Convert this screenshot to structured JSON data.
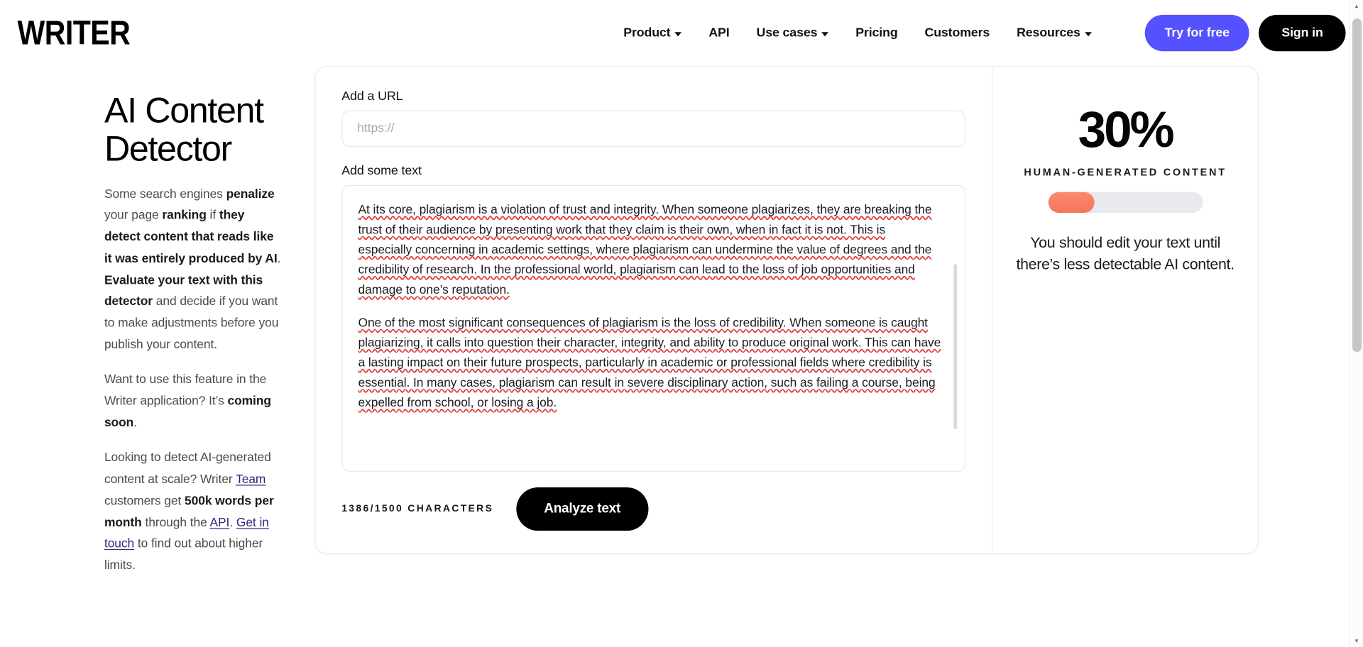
{
  "header": {
    "logo": "WRITER",
    "nav": [
      {
        "label": "Product",
        "has_caret": true
      },
      {
        "label": "API",
        "has_caret": false
      },
      {
        "label": "Use cases",
        "has_caret": true
      },
      {
        "label": "Pricing",
        "has_caret": false
      },
      {
        "label": "Customers",
        "has_caret": false
      },
      {
        "label": "Resources",
        "has_caret": true
      }
    ],
    "try_label": "Try for free",
    "signin_label": "Sign in",
    "try_color": "#5551FF",
    "signin_color": "#000000"
  },
  "left": {
    "title": "AI Content Detector",
    "p1_a": "Some search engines ",
    "p1_b": "penalize",
    "p1_c": " your page ",
    "p1_d": "ranking",
    "p1_e": " if ",
    "p1_f": "they detect content that reads like it was entirely produced by AI",
    "p1_g": ". ",
    "p1_h": "Evaluate your text with this detector",
    "p1_i": " and decide if you want to make adjustments before you publish your content.",
    "p2_a": "Want to use this feature in the Writer application? It’s ",
    "p2_b": "coming soon",
    "p2_c": ".",
    "p3_a": "Looking to detect AI-generated content at scale? Writer ",
    "p3_link1": "Team",
    "p3_b": " customers get ",
    "p3_c": "500k words per month",
    "p3_d": " through the ",
    "p3_link2": "API",
    "p3_e": ". ",
    "p3_link3": "Get in touch",
    "p3_f": " to find out about higher limits."
  },
  "form": {
    "url_label": "Add a URL",
    "url_placeholder": "https://",
    "url_value": "",
    "text_label": "Add some text",
    "text_paragraph_1": "At its core, plagiarism is a violation of trust and integrity. When someone plagiarizes, they are breaking the trust of their audience by presenting work that they claim is their own, when in fact it is not. This is especially concerning in academic settings, where plagiarism can undermine the value of degrees and the credibility of research. In the professional world, plagiarism can lead to the loss of job opportunities and damage to one’s reputation.",
    "text_paragraph_2": "One of the most significant consequences of plagiarism is the loss of credibility. When someone is caught plagiarizing, it calls into question their character, integrity, and ability to produce original work. This can have a lasting impact on their future prospects, particularly in academic or professional fields where credibility is essential. In many cases, plagiarism can result in severe disciplinary action, such as failing a course, being expelled from school, or losing a job.",
    "char_count": "1386/1500 CHARACTERS",
    "analyze_label": "Analyze text"
  },
  "score": {
    "value": "30%",
    "percent": 30,
    "caption": "HUMAN-GENERATED CONTENT",
    "advice": "You should edit your text until there’s less detectable AI content.",
    "fill_color": "#F4755A",
    "track_color": "#E9EAEF"
  },
  "scrollbar": {
    "up_arrow": "▲",
    "down_arrow": "▼"
  }
}
